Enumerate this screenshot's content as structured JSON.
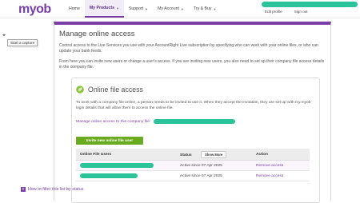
{
  "brand": {
    "logo": "myob"
  },
  "nav": [
    {
      "label": "Home",
      "dropdown": false
    },
    {
      "label": "My Products",
      "dropdown": true,
      "active": true
    },
    {
      "label": "Support",
      "dropdown": true
    },
    {
      "label": "My Account",
      "dropdown": true
    },
    {
      "label": "Try & Buy",
      "dropdown": true
    }
  ],
  "user_menu": {
    "edit_profile": "Edit profile",
    "sign_out": "Sign out"
  },
  "tooltip": "Start a capture",
  "page": {
    "title": "Manage online access",
    "intro1": "Control access to the Live Services you use with your AccountRight Live subscription by specifying who can work with your online files, or who can update your bank feeds.",
    "intro2": "From here you can invite new users or change a user's access. If you are inviting new users, you also need to set up their company file access details in the company file."
  },
  "card": {
    "title": "Online file access",
    "body": "To work with a company file online, a person needs to be invited to use it. When they accept the invitation, they are set up with my.myob login details that will allow them to access the online file.",
    "manage_label": "Manage online access to this company file:",
    "invite_button": "Invite new online file user"
  },
  "table": {
    "headers": {
      "user": "Online File Users",
      "status": "Status",
      "show_more": "Show More",
      "action": "Action"
    },
    "rows": [
      {
        "status": "Active since 07 Apr 2025",
        "action": "Remove access"
      },
      {
        "status": "Active since 07 Apr 2025",
        "action": "Remove access"
      }
    ]
  },
  "filter_help": "How to filter this list by status",
  "colors": {
    "brand": "#7a3fa6",
    "invite_button": "#69aa1f",
    "redaction": "#2bc39a"
  }
}
